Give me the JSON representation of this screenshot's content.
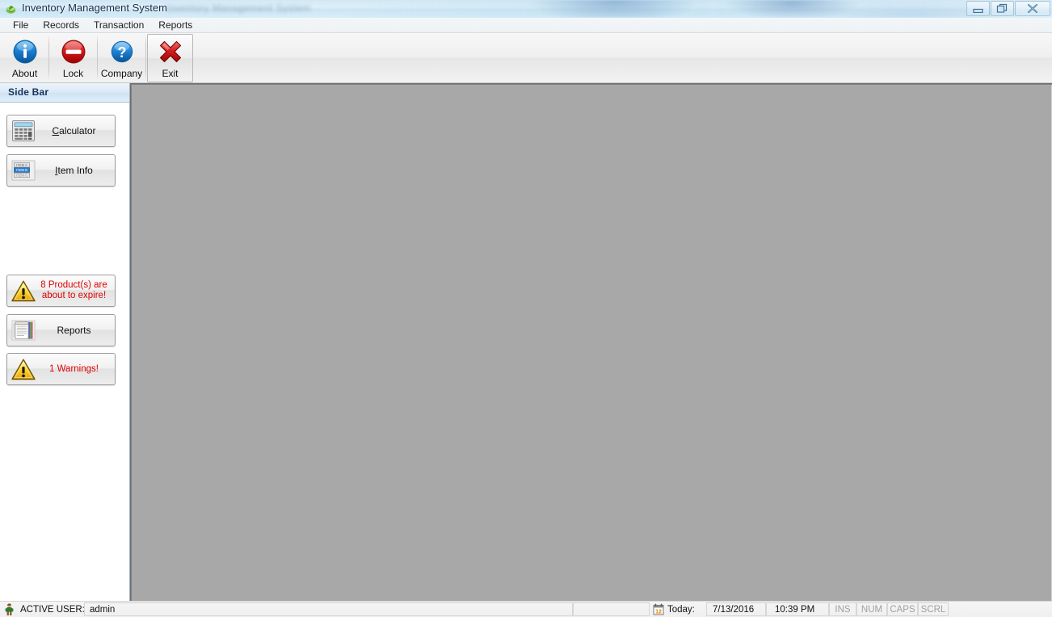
{
  "window": {
    "title": "Inventory Management System",
    "icon": "app-leaf-icon",
    "ghost_text": "Inventory Management System",
    "controls": [
      {
        "name": "minimize",
        "glyph": "minimize-icon"
      },
      {
        "name": "restore",
        "glyph": "restore-icon"
      },
      {
        "name": "close",
        "glyph": "close-icon"
      }
    ]
  },
  "menubar": {
    "items": [
      {
        "label": "File"
      },
      {
        "label": "Records"
      },
      {
        "label": "Transaction"
      },
      {
        "label": "Reports"
      }
    ]
  },
  "toolbar": {
    "buttons": [
      {
        "label": "About",
        "icon": "info-circle-icon",
        "selected": false
      },
      {
        "label": "Lock",
        "icon": "no-entry-icon",
        "selected": false
      },
      {
        "label": "Company",
        "icon": "question-circle-icon",
        "selected": false
      },
      {
        "label": "Exit",
        "icon": "red-x-icon",
        "selected": true
      }
    ]
  },
  "sidebar": {
    "title": "Side Bar",
    "buttons": [
      {
        "label": "Calculator",
        "mnemonic_before": "",
        "mnemonic": "C",
        "mnemonic_after": "alculator",
        "icon": "calculator-icon",
        "warning": false
      },
      {
        "label": "Item Info",
        "mnemonic_before": "",
        "mnemonic": "I",
        "mnemonic_after": "tem Info",
        "icon": "item-list-icon",
        "warning": false
      },
      {
        "label": "8 Product(s) are about to expire!",
        "line1": "8 Product(s) are",
        "line2": "about to expire!",
        "icon": "warning-triangle-icon",
        "warning": true
      },
      {
        "label": "Reports",
        "mnemonic_before": "Reports",
        "mnemonic": "",
        "mnemonic_after": "",
        "icon": "report-document-icon",
        "warning": false
      },
      {
        "label": "1 Warnings!",
        "line1": "1 Warnings!",
        "line2": "",
        "icon": "warning-triangle-icon",
        "warning": true
      }
    ]
  },
  "statusbar": {
    "user_icon": "person-icon",
    "active_user_label": "ACTIVE USER:",
    "active_user_value": "admin",
    "empty_panel": "",
    "calendar_icon": "calendar-icon",
    "today_label": "Today:",
    "date_value": "7/13/2016",
    "time_value": "10:39 PM",
    "indicators": [
      {
        "label": "INS",
        "active": false
      },
      {
        "label": "NUM",
        "active": false
      },
      {
        "label": "CAPS",
        "active": false
      },
      {
        "label": "SCRL",
        "active": false
      }
    ]
  },
  "colors": {
    "mdi_background": "#a8a8a8",
    "warning_text": "#e00000",
    "sidebar_title": "#16335a",
    "title_text": "#13314e"
  }
}
